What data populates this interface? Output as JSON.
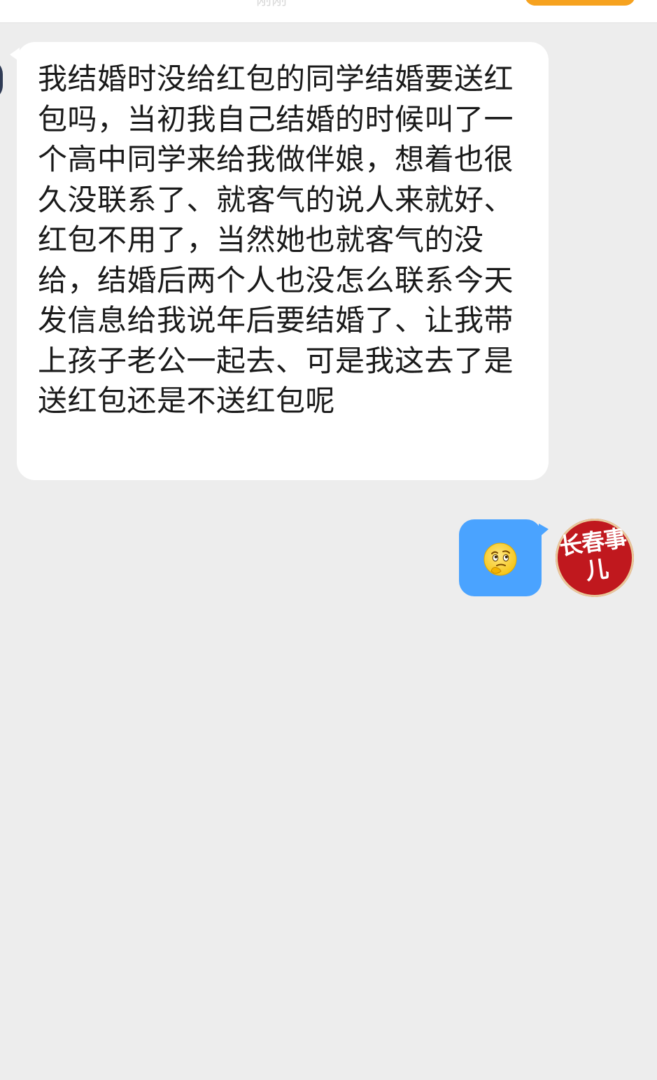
{
  "header": {
    "time_text": "刚刚"
  },
  "messages": [
    {
      "side": "left",
      "type": "text",
      "text": "我结婚时没给红包的同学结婚要送红包吗，当初我自己结婚的时候叫了一个高中同学来给我做伴娘，想着也很久没联系了、就客气的说人来就好、红包不用了，当然她也就客气的没给，结婚后两个人也没怎么联系今天发信息给我说年后要结婚了、让我带上孩子老公一起去、可是我这去了是送红包还是不送红包呢"
    },
    {
      "side": "right",
      "type": "emoji",
      "emoji_name": "thinking-face-icon"
    }
  ],
  "avatar_right": {
    "logo_text": "长春事儿"
  },
  "colors": {
    "background": "#ededed",
    "bubble_left": "#ffffff",
    "bubble_right": "#4aa3ff",
    "avatar_red": "#c0181e",
    "header_button": "#f6a21f"
  }
}
